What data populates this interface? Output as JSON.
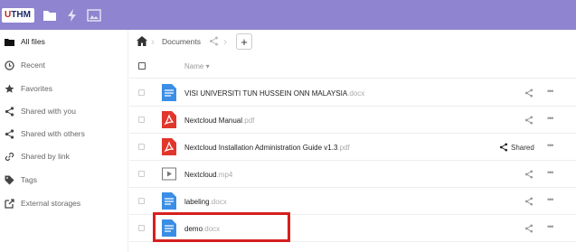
{
  "header": {
    "logo_text_accent": "U",
    "logo_text_rest": "THM",
    "apps": [
      {
        "icon": "folder-icon",
        "name": "files"
      },
      {
        "icon": "lightning-icon",
        "name": "activity"
      },
      {
        "icon": "image-icon",
        "name": "gallery"
      }
    ],
    "bg_color": "#8e84cf"
  },
  "sidebar": {
    "items": [
      {
        "label": "All files",
        "icon": "folder-icon",
        "active": true
      },
      {
        "label": "Recent",
        "icon": "clock-icon"
      },
      {
        "label": "Favorites",
        "icon": "star-icon"
      },
      {
        "label": "Shared with you",
        "icon": "share-icon"
      },
      {
        "label": "Shared with others",
        "icon": "share-icon"
      },
      {
        "label": "Shared by link",
        "icon": "link-icon"
      },
      {
        "label": "Tags",
        "icon": "tag-icon"
      },
      {
        "label": "External storages",
        "icon": "external-icon"
      }
    ]
  },
  "breadcrumb": {
    "current": "Documents",
    "add_label": "+"
  },
  "table": {
    "name_header": "Name ▾",
    "rows": [
      {
        "name": "VISI UNIVERSITI TUN HUSSEIN ONN MALAYSIA",
        "ext": ".docx",
        "type": "doc"
      },
      {
        "name": "Nextcloud Manual",
        "ext": ".pdf",
        "type": "pdf"
      },
      {
        "name": "Nextcloud Installation Administration Guide v1.3",
        "ext": ".pdf",
        "type": "pdf",
        "shared": "Shared"
      },
      {
        "name": "Nextcloud",
        "ext": ".mp4",
        "type": "video"
      },
      {
        "name": "labeling",
        "ext": ".docx",
        "type": "doc"
      },
      {
        "name": "demo",
        "ext": ".docx",
        "type": "doc"
      }
    ],
    "menu_glyph": "•••"
  },
  "colors": {
    "doc": "#3a8ee6",
    "pdf": "#e1362b",
    "highlight": "#d61f1f"
  }
}
